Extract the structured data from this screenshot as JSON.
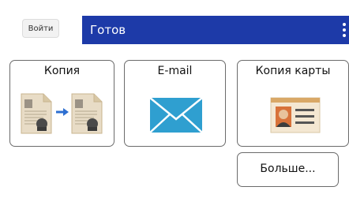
{
  "header": {
    "login_label": "Войти",
    "status_text": "Готов"
  },
  "tiles": [
    {
      "label": "Копия",
      "icon": "copy-icon"
    },
    {
      "label": "E-mail",
      "icon": "email-icon"
    },
    {
      "label": "Копия карты",
      "icon": "id-card-copy-icon"
    }
  ],
  "more_label": "Больше...",
  "colors": {
    "status_bar": "#1d3aa8",
    "email_icon": "#2f9fd0",
    "tile_border": "#6b6b6b"
  }
}
